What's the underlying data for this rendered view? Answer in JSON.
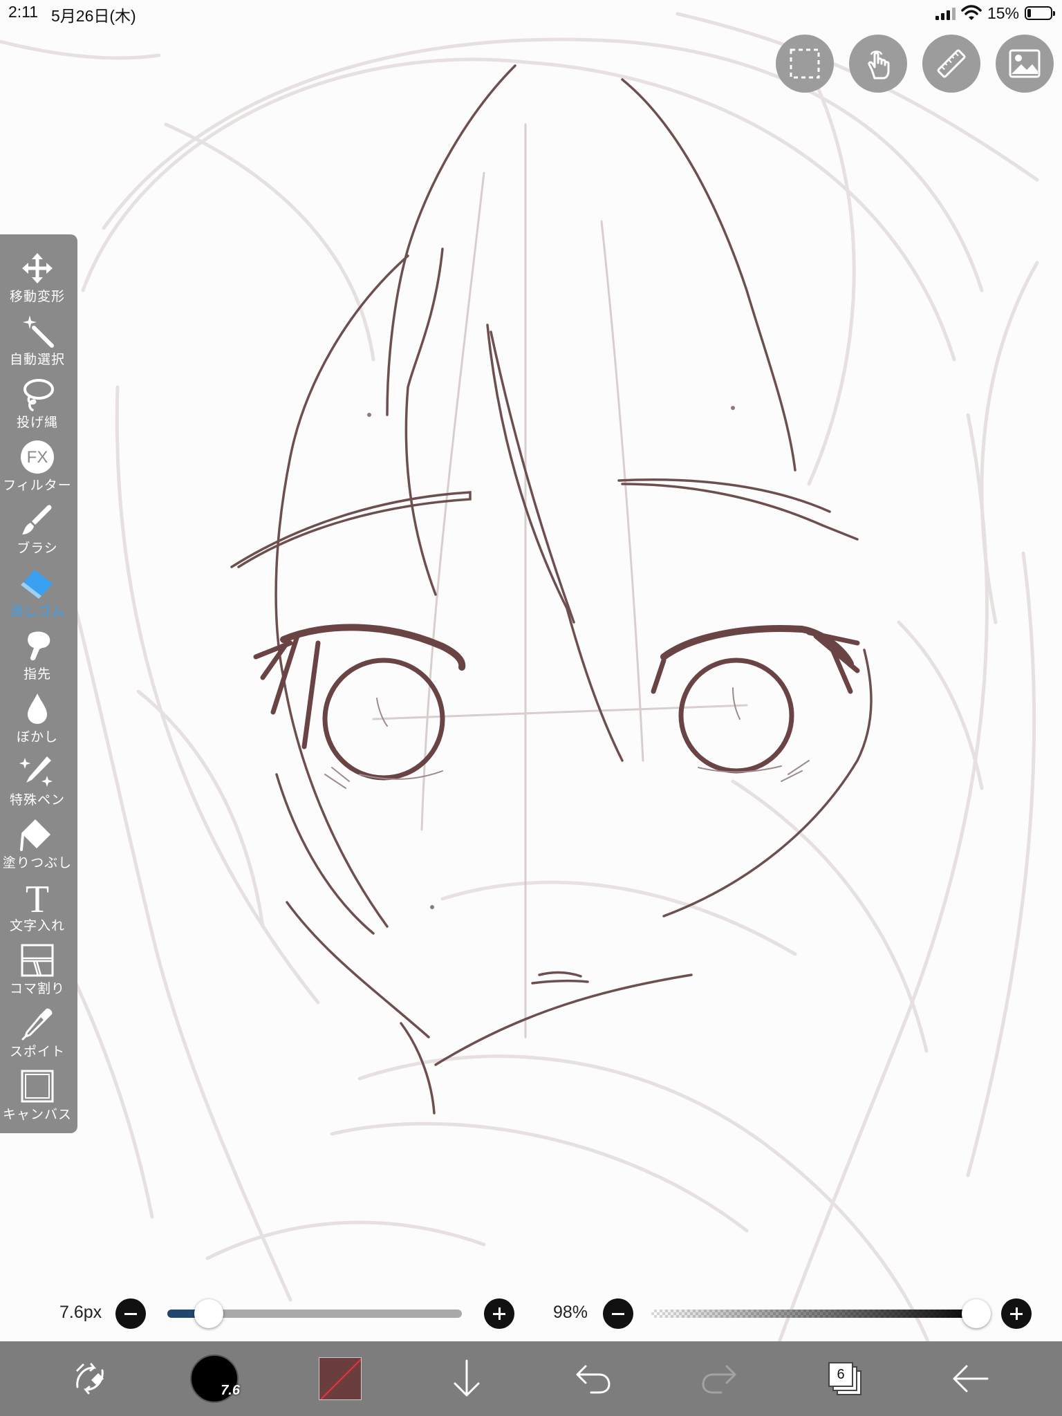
{
  "status_bar": {
    "time": "2:11",
    "date": "5月26日(木)",
    "battery_percent": "15%",
    "battery_level": 0.15,
    "signal_icon": "cellular-signal-icon",
    "wifi_icon": "wifi-icon"
  },
  "top_buttons": [
    {
      "name": "selection-layer-button",
      "icon": "dashed-rect-selection-icon"
    },
    {
      "name": "gesture-touch-button",
      "icon": "touch-hand-icon"
    },
    {
      "name": "ruler-button",
      "icon": "ruler-icon"
    },
    {
      "name": "material-image-button",
      "icon": "image-icon"
    }
  ],
  "tools": [
    {
      "label": "移動変形",
      "icon": "move-transform-icon"
    },
    {
      "label": "自動選択",
      "icon": "magic-wand-icon"
    },
    {
      "label": "投げ縄",
      "icon": "lasso-icon"
    },
    {
      "label": "フィルター",
      "icon": "fx-filter-icon",
      "icon_text": "FX"
    },
    {
      "label": "ブラシ",
      "icon": "brush-icon"
    },
    {
      "label": "消しゴム",
      "icon": "eraser-icon",
      "active": true
    },
    {
      "label": "指先",
      "icon": "finger-smudge-icon"
    },
    {
      "label": "ぼかし",
      "icon": "blur-drop-icon"
    },
    {
      "label": "特殊ペン",
      "icon": "special-pen-icon"
    },
    {
      "label": "塗りつぶし",
      "icon": "bucket-fill-icon"
    },
    {
      "label": "文字入れ",
      "icon": "text-icon",
      "icon_text": "T"
    },
    {
      "label": "コマ割り",
      "icon": "frame-divider-icon"
    },
    {
      "label": "スポイト",
      "icon": "eyedropper-icon"
    },
    {
      "label": "キャンバス",
      "icon": "canvas-icon"
    }
  ],
  "brush_size": {
    "label": "7.6px",
    "level": 0.14
  },
  "opacity": {
    "label": "98%",
    "level": 0.98
  },
  "bottom_bar": {
    "brush_size_badge": "7.6",
    "current_color": "#6b3d3e",
    "layer_count": "6",
    "icons": [
      "transform-swap-icon",
      "brush-size-icon",
      "color-swatch-icon",
      "download-arrow-icon",
      "undo-icon",
      "redo-icon",
      "layers-icon",
      "back-arrow-icon"
    ]
  },
  "colors": {
    "accent": "#3aa0f0",
    "line_art": "#6b4a4a",
    "sketch": "#e3dcdc",
    "toolbar": "#7d7d7d",
    "tool_panel": "#8a8a8a"
  }
}
